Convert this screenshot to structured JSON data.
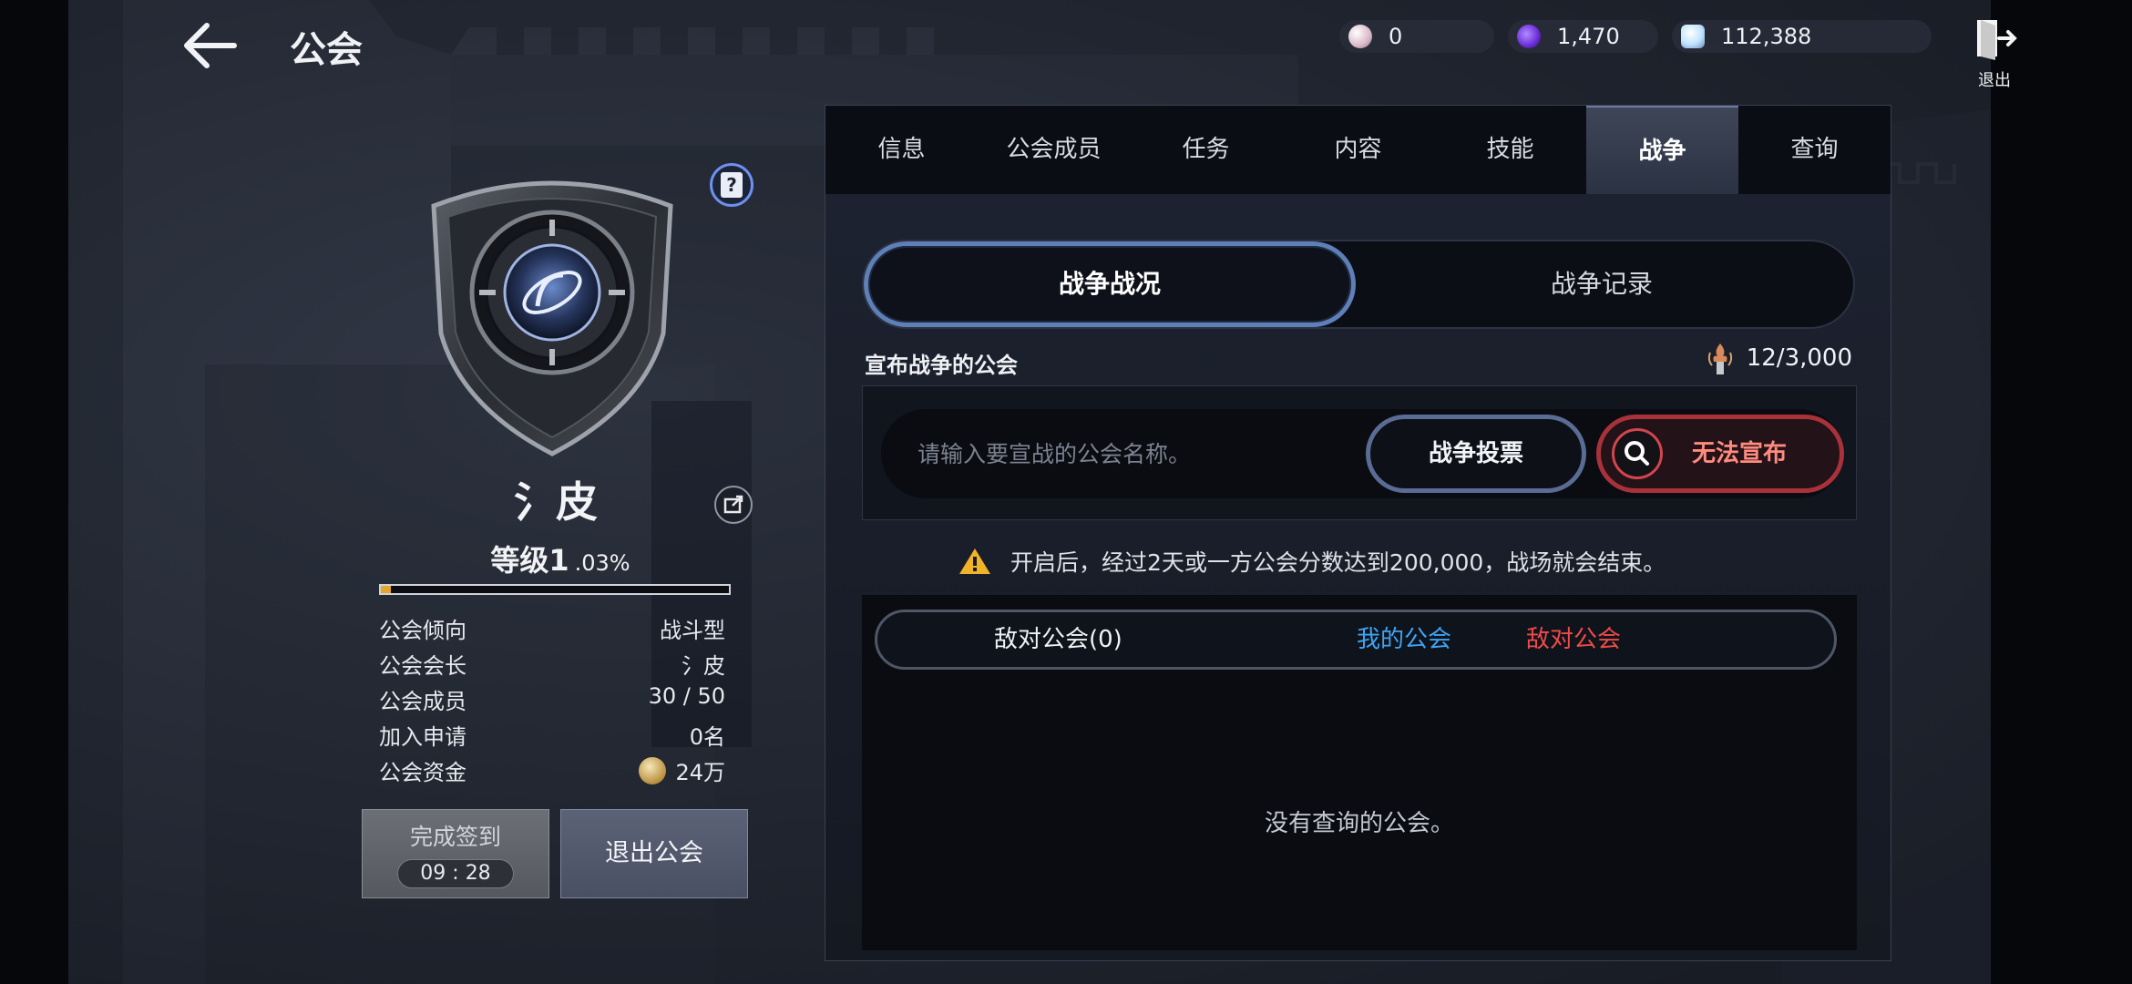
{
  "header": {
    "title": "公会",
    "currencies": [
      {
        "icon": "pearl-icon",
        "value": "0",
        "color": "#d9b8c8"
      },
      {
        "icon": "purple-gem-icon",
        "value": "1,470",
        "color": "#6a2bd6"
      },
      {
        "icon": "crystal-icon",
        "value": "112,388",
        "color": "#bfe3ff"
      }
    ],
    "exit_label": "退出"
  },
  "guild": {
    "name": "氵皮",
    "level_label": "等级1",
    "level_percent": ".03%",
    "exp_fraction": 0.03,
    "info": [
      {
        "key": "公会倾向",
        "value": "战斗型"
      },
      {
        "key": "公会会长",
        "value": "氵皮"
      },
      {
        "key": "公会成员",
        "value": "30 / 50"
      },
      {
        "key": "加入申请",
        "value": "0名"
      },
      {
        "key": "公会资金",
        "value": "24万"
      }
    ],
    "checkin_label": "完成签到",
    "checkin_timer": "09 : 28",
    "leave_label": "退出公会"
  },
  "tabs": [
    "信息",
    "公会成员",
    "任务",
    "内容",
    "技能",
    "战争",
    "查询"
  ],
  "active_tab": 5,
  "war": {
    "subtabs": [
      "战争战况",
      "战争记录"
    ],
    "declare_title": "宣布战争的公会",
    "declare_count": "12/3,000",
    "search_placeholder": "请输入要宣战的公会名称。",
    "vote_label": "战争投票",
    "declare_label": "无法宣布",
    "notice": "开启后，经过2天或一方公会分数达到200,000，战场就会结束。",
    "list_title": "敌对公会(0)",
    "legend_mine": "我的公会",
    "legend_enemy": "敌对公会",
    "empty_message": "没有查询的公会。"
  },
  "colors": {
    "accent_blue": "#5e7fb8",
    "danger_red": "#a9323a",
    "my_guild": "#3fa4f4",
    "enemy_guild": "#ef4b48",
    "exp_fill": "#e3a52c"
  }
}
